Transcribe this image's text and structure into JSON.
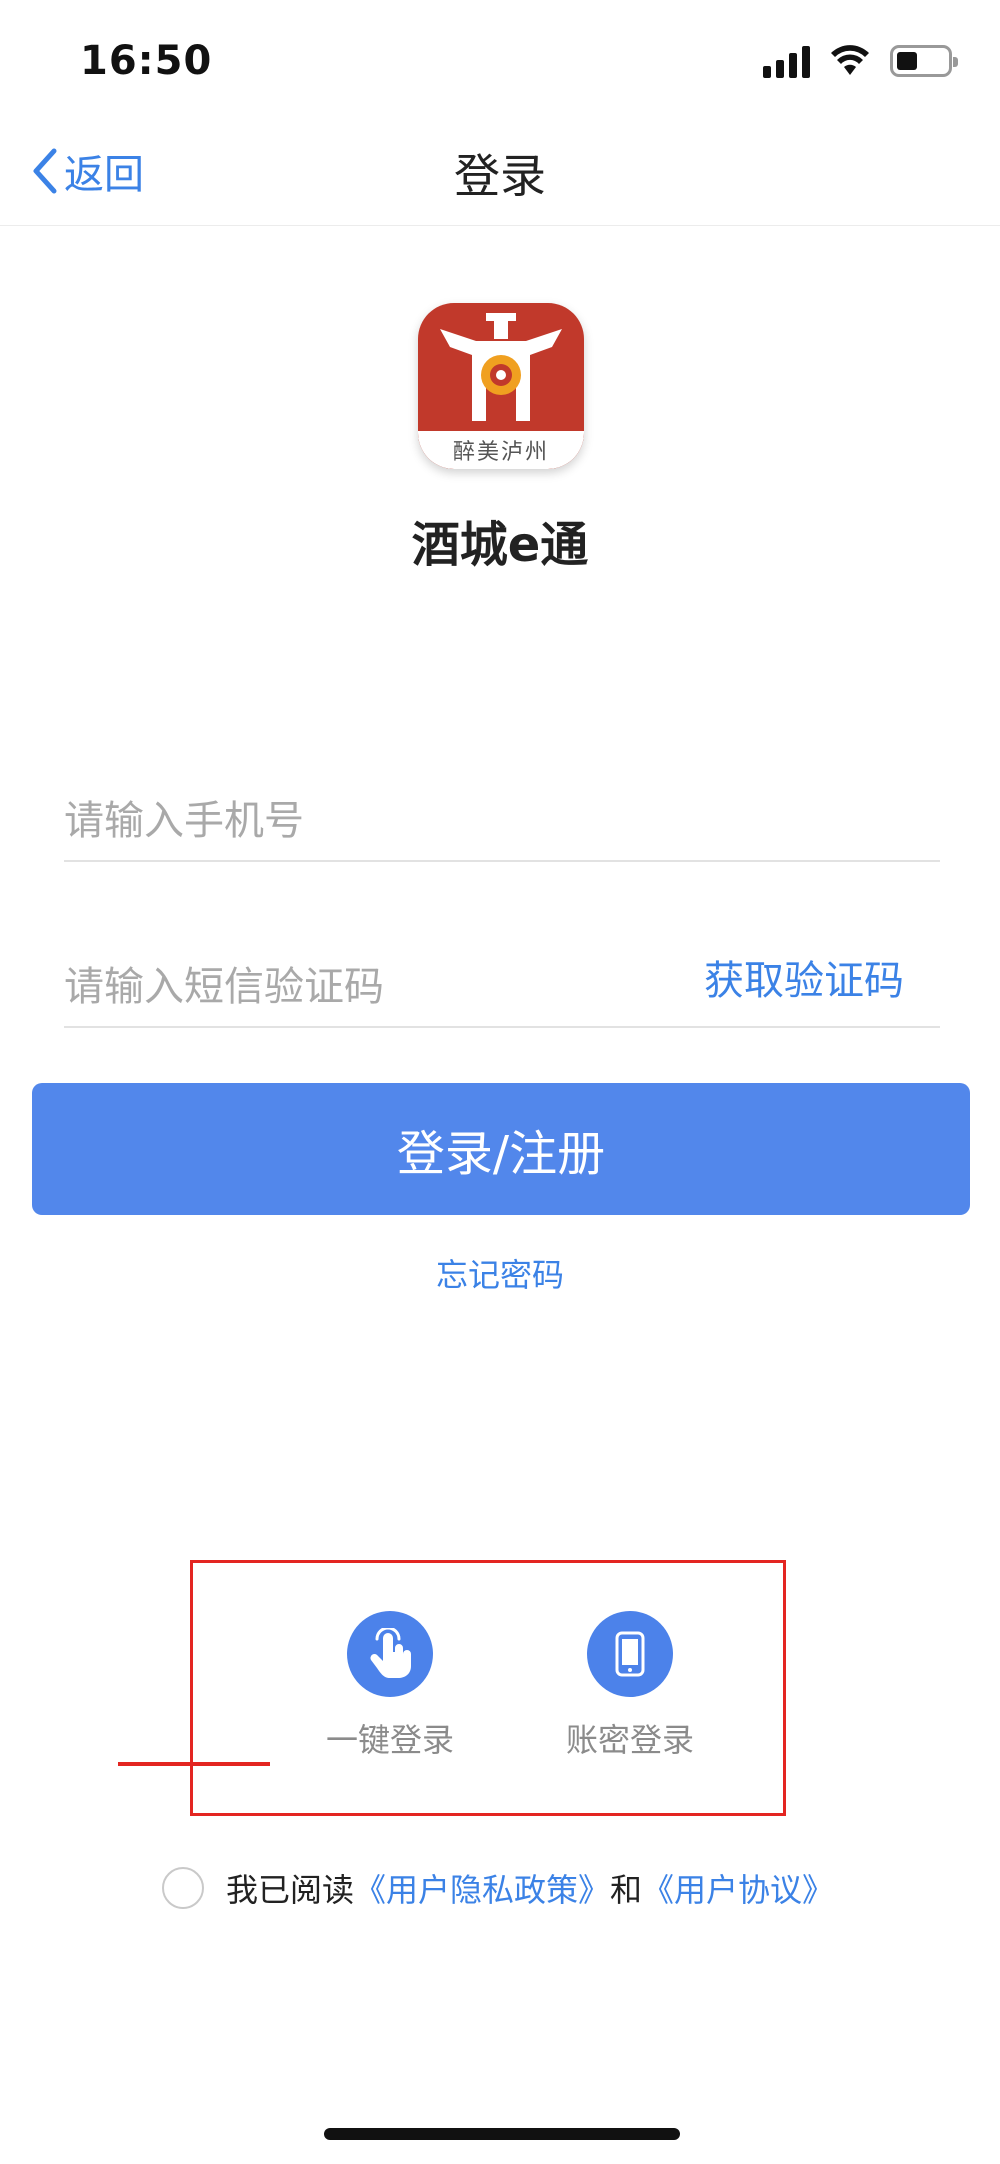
{
  "status_bar": {
    "time": "16:50"
  },
  "nav": {
    "back_label": "返回",
    "title": "登录"
  },
  "app": {
    "name": "酒城e通",
    "logo_text": "醉美泸州"
  },
  "form": {
    "phone_placeholder": "请输入手机号",
    "phone_value": "",
    "code_placeholder": "请输入短信验证码",
    "code_value": "",
    "get_code_label": "获取验证码",
    "submit_label": "登录/注册",
    "forgot_label": "忘记密码"
  },
  "alt_login": {
    "one_tap_label": "一键登录",
    "account_label": "账密登录"
  },
  "agreement": {
    "prefix": "我已阅读",
    "privacy_link": "《用户隐私政策》",
    "connector": "和",
    "terms_link": "《用户协议》"
  },
  "colors": {
    "accent": "#5287eb",
    "link": "#3b82e6",
    "highlight": "#e32521",
    "logo": "#c1392b"
  },
  "icons": {
    "back": "chevron-left-icon",
    "one_tap": "hand-tap-icon",
    "account": "phone-icon"
  }
}
